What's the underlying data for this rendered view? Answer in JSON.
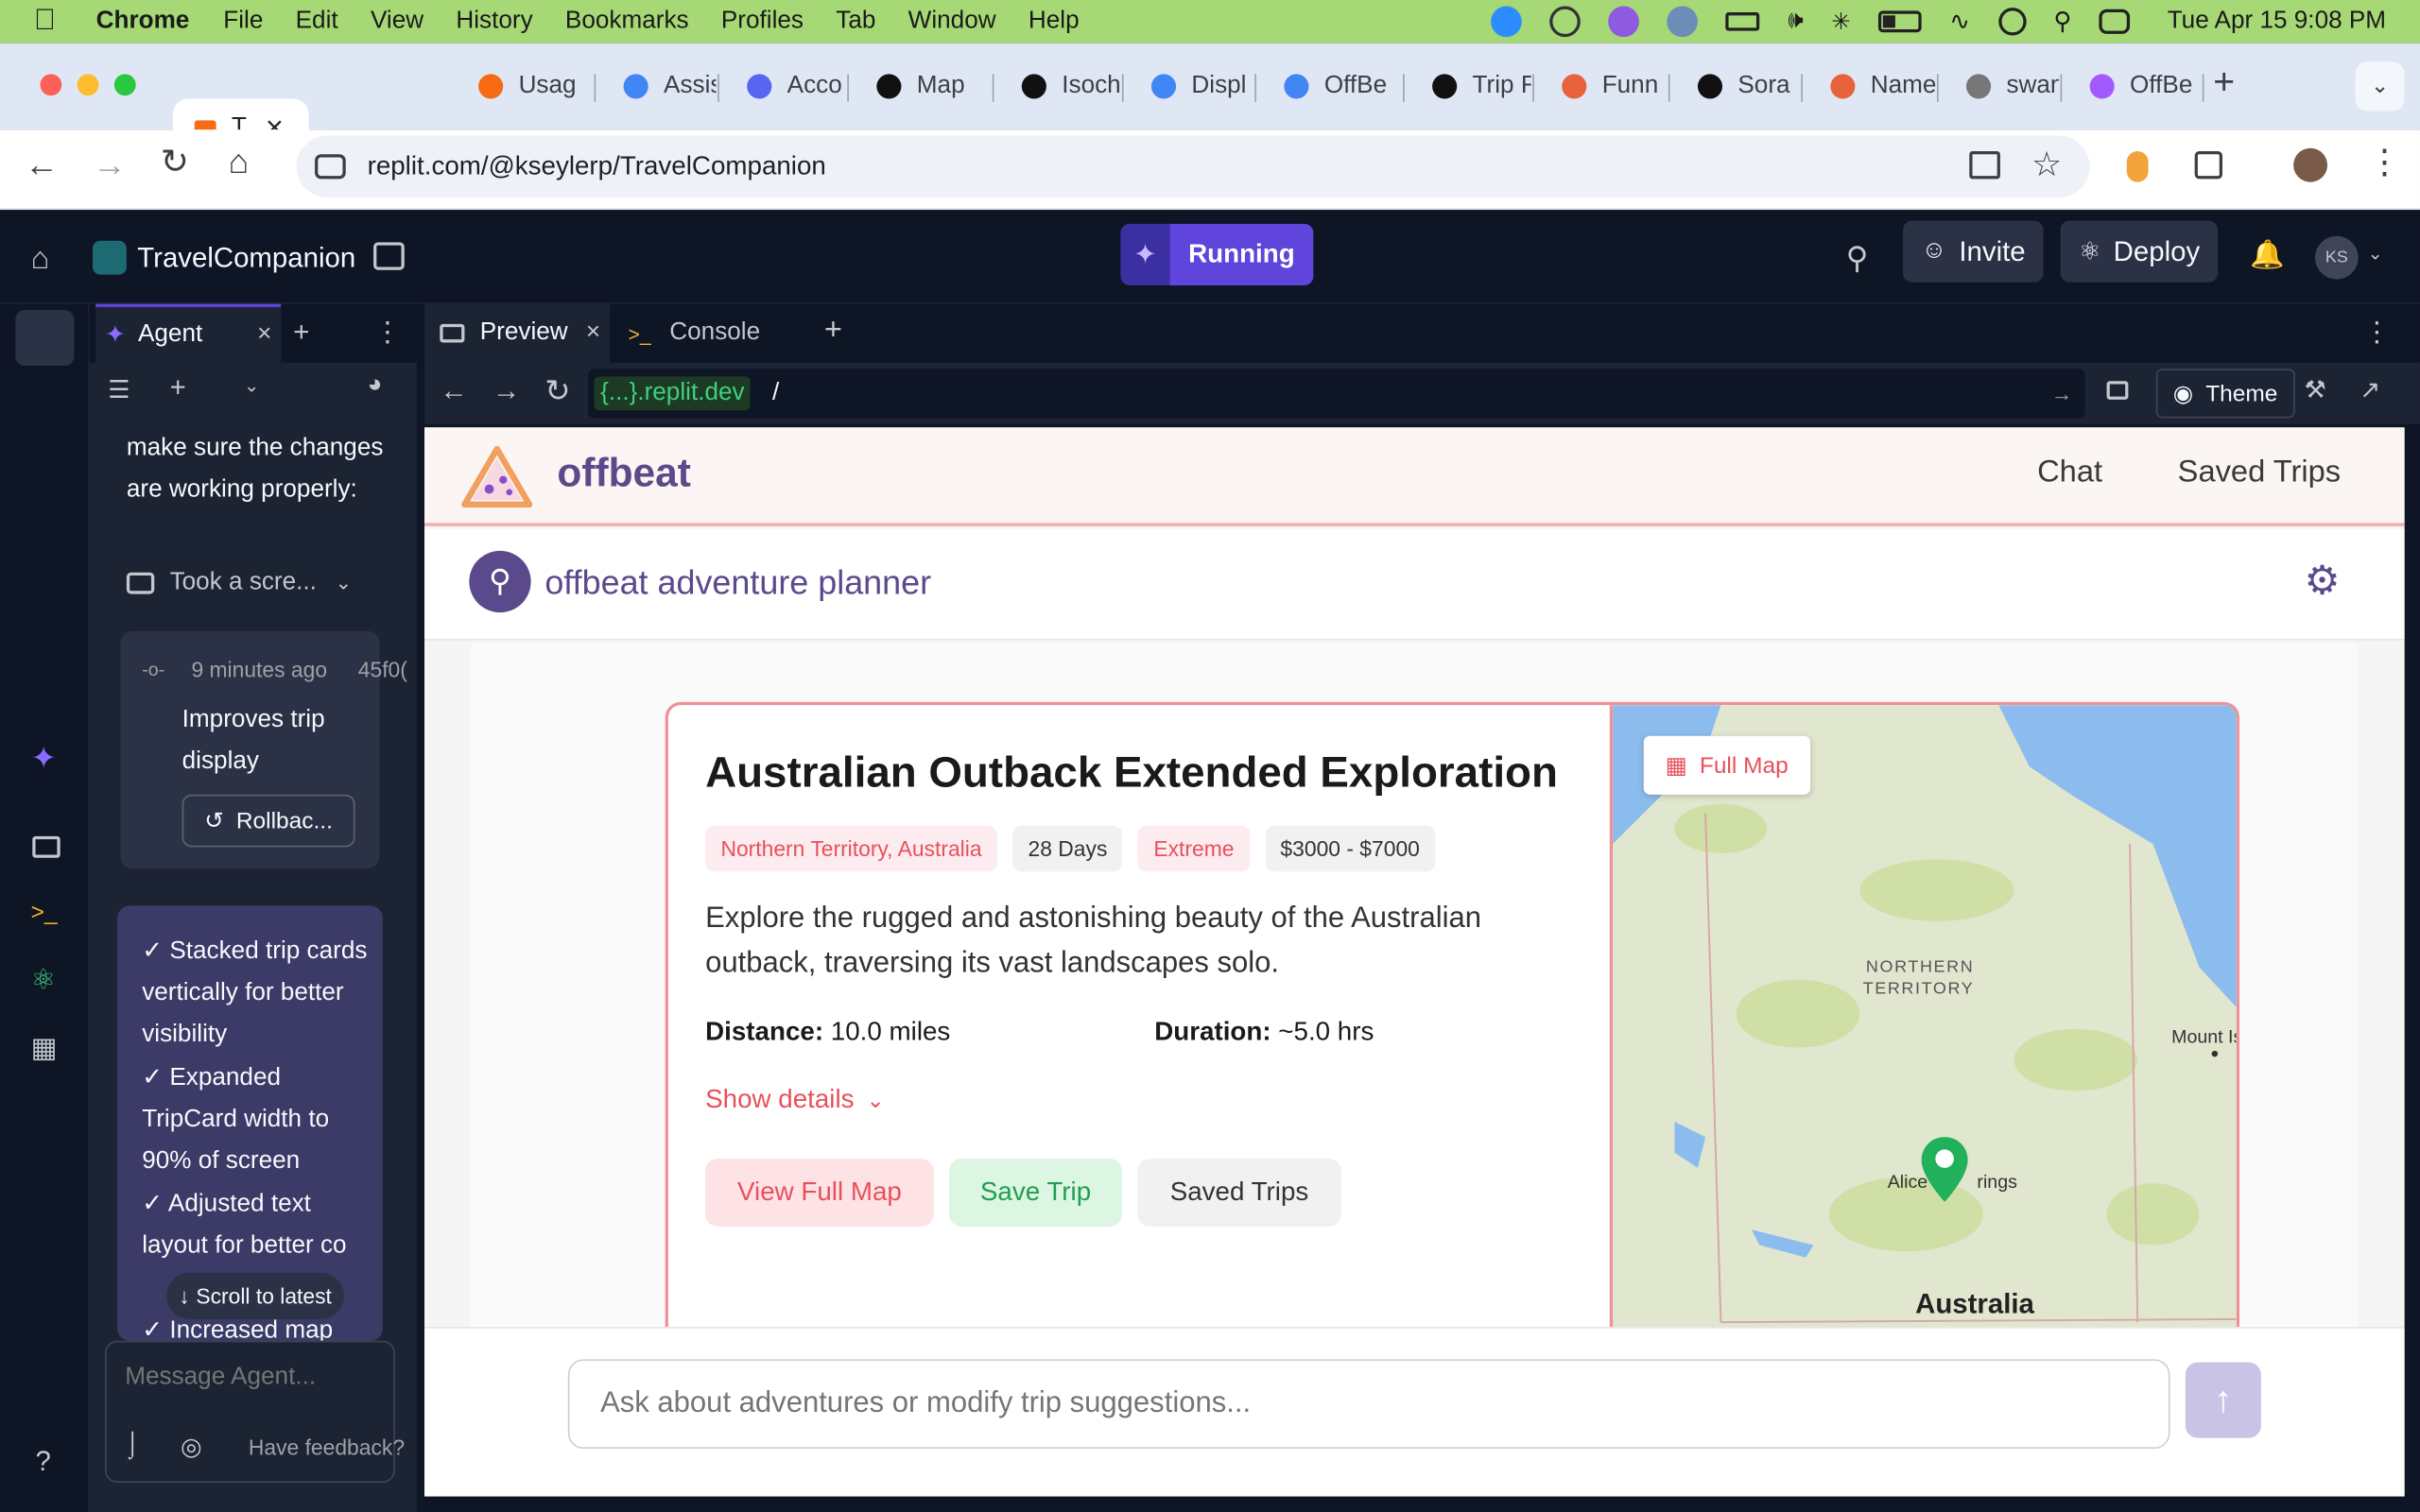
{
  "menubar": {
    "app": "Chrome",
    "items": [
      "File",
      "Edit",
      "View",
      "History",
      "Bookmarks",
      "Profiles",
      "Tab",
      "Window",
      "Help"
    ],
    "clock": "Tue Apr 15  9:08 PM"
  },
  "tabs": [
    {
      "label": "T",
      "color": "#f76b15"
    },
    {
      "label": "Usag",
      "color": "#f76b15"
    },
    {
      "label": "Assis",
      "color": "#4285f4"
    },
    {
      "label": "Acco",
      "color": "#5865f2"
    },
    {
      "label": "Map",
      "color": "#111111"
    },
    {
      "label": "Isoch",
      "color": "#111111"
    },
    {
      "label": "Displ",
      "color": "#4285f4"
    },
    {
      "label": "OffBe",
      "color": "#4285f4"
    },
    {
      "label": "Trip F",
      "color": "#111111"
    },
    {
      "label": "Funn",
      "color": "#e8623c"
    },
    {
      "label": "Sora",
      "color": "#111111"
    },
    {
      "label": "Name",
      "color": "#e8623c"
    },
    {
      "label": "swan",
      "color": "#777777"
    },
    {
      "label": "OffBe",
      "color": "#a259ff"
    }
  ],
  "omnibox": {
    "url": "replit.com/@kseylerp/TravelCompanion"
  },
  "replit": {
    "project": "TravelCompanion",
    "status": "Running",
    "invite": "Invite",
    "deploy": "Deploy",
    "avatar": "KS"
  },
  "agent": {
    "tab_label": "Agent",
    "intro_text": "make sure the changes are working properly:",
    "screenshot_label": "Took a scre...",
    "checkpoint": {
      "time": "9 minutes ago",
      "hash": "45f0(",
      "message": "Improves trip display",
      "rollback": "Rollbac..."
    },
    "summary_lines": [
      "✓ Stacked trip cards vertically for better visibility",
      "✓ Expanded TripCard width to 90% of screen",
      "✓ Adjusted text layout for better co",
      "✓ Increased map"
    ],
    "scroll_latest": "Scroll to latest",
    "input_placeholder": "Message Agent...",
    "feedback": "Have feedback?"
  },
  "pane_tabs": {
    "preview": "Preview",
    "console": "Console"
  },
  "preview_url": {
    "domain": "{...}.replit.dev",
    "path": "/",
    "theme": "Theme"
  },
  "app": {
    "brand": "offbeat",
    "nav": [
      "Chat",
      "Saved Trips"
    ],
    "planner_title": "offbeat adventure planner",
    "trip": {
      "title": "Australian Outback Extended Exploration",
      "location": "Northern Territory, Australia",
      "days": "28 Days",
      "difficulty": "Extreme",
      "price": "$3000 - $7000",
      "description": "Explore the rugged and astonishing beauty of the Australian outback, traversing its vast landscapes solo.",
      "distance_label": "Distance:",
      "distance_value": "10.0 miles",
      "duration_label": "Duration:",
      "duration_value": "~5.0 hrs",
      "show_details": "Show details",
      "buttons": {
        "view_map": "View Full Map",
        "save": "Save Trip",
        "saved": "Saved Trips"
      }
    },
    "map": {
      "full_map": "Full Map",
      "labels": {
        "territory1": "NORTHERN",
        "territory2": "TERRITORY",
        "mount": "Mount Is",
        "alice_left": "Alice",
        "alice_right": "rings",
        "country": "Australia"
      }
    },
    "chat_placeholder": "Ask about adventures or modify trip suggestions..."
  },
  "colors": {
    "accent": "#5b4a8b",
    "replit_purple": "#5f45db",
    "pink": "#e8505b",
    "green": "#20b15a",
    "map_water": "#8cbcee",
    "map_land": "#dfe5c8"
  }
}
